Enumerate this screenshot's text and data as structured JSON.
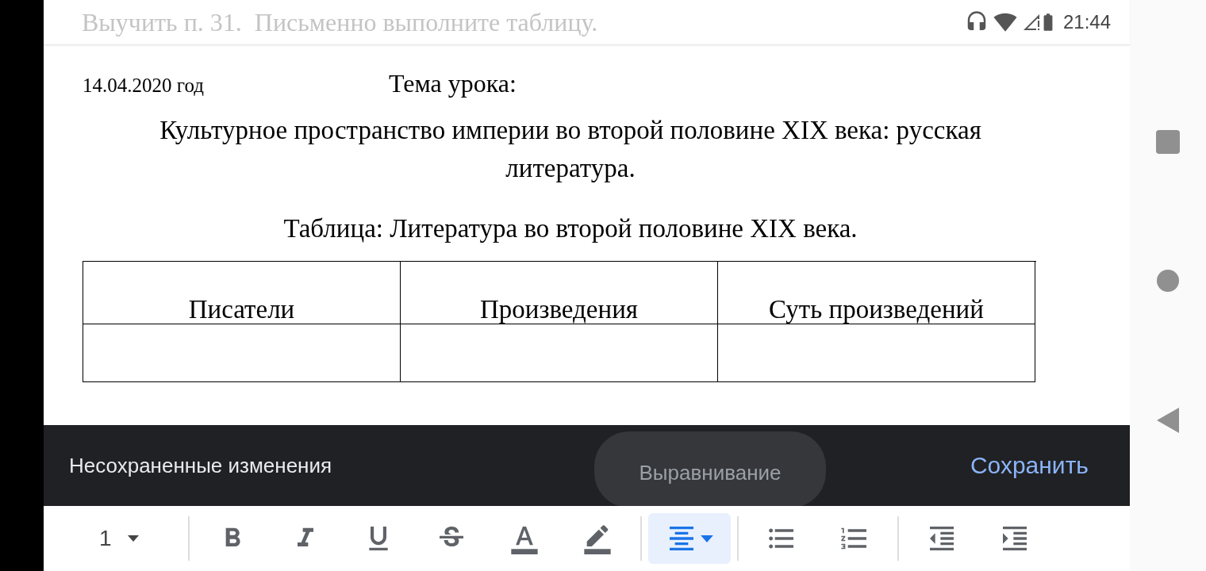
{
  "status_bar": {
    "faded_text": "Выучить п. 31.  Письменно выполните таблицу.",
    "time": "21:44"
  },
  "document": {
    "date": "14.04.2020 год",
    "topic_label": "Тема урока:",
    "title": "Культурное пространство империи во второй половине XIX века: русская литература.",
    "table_caption": "Таблица: Литература во второй половине XIX века.",
    "table": {
      "columns": [
        "Писатели",
        "Произведения",
        "Суть произведений"
      ]
    }
  },
  "snackbar": {
    "message": "Несохраненные изменения",
    "action": "Сохранить"
  },
  "toast": {
    "text": "Выравнивание"
  },
  "toolbar": {
    "font_size": "1",
    "items": [
      {
        "kind": "bold",
        "selected": false
      },
      {
        "kind": "italic",
        "selected": false
      },
      {
        "kind": "underline",
        "selected": false
      },
      {
        "kind": "strike",
        "selected": false
      },
      {
        "kind": "textcolor",
        "selected": false
      },
      {
        "kind": "highlight",
        "selected": false
      },
      {
        "kind": "align",
        "selected": true
      },
      {
        "kind": "bullets",
        "selected": false
      },
      {
        "kind": "numbers",
        "selected": false
      },
      {
        "kind": "outdent",
        "selected": false
      },
      {
        "kind": "indent",
        "selected": false
      }
    ]
  }
}
